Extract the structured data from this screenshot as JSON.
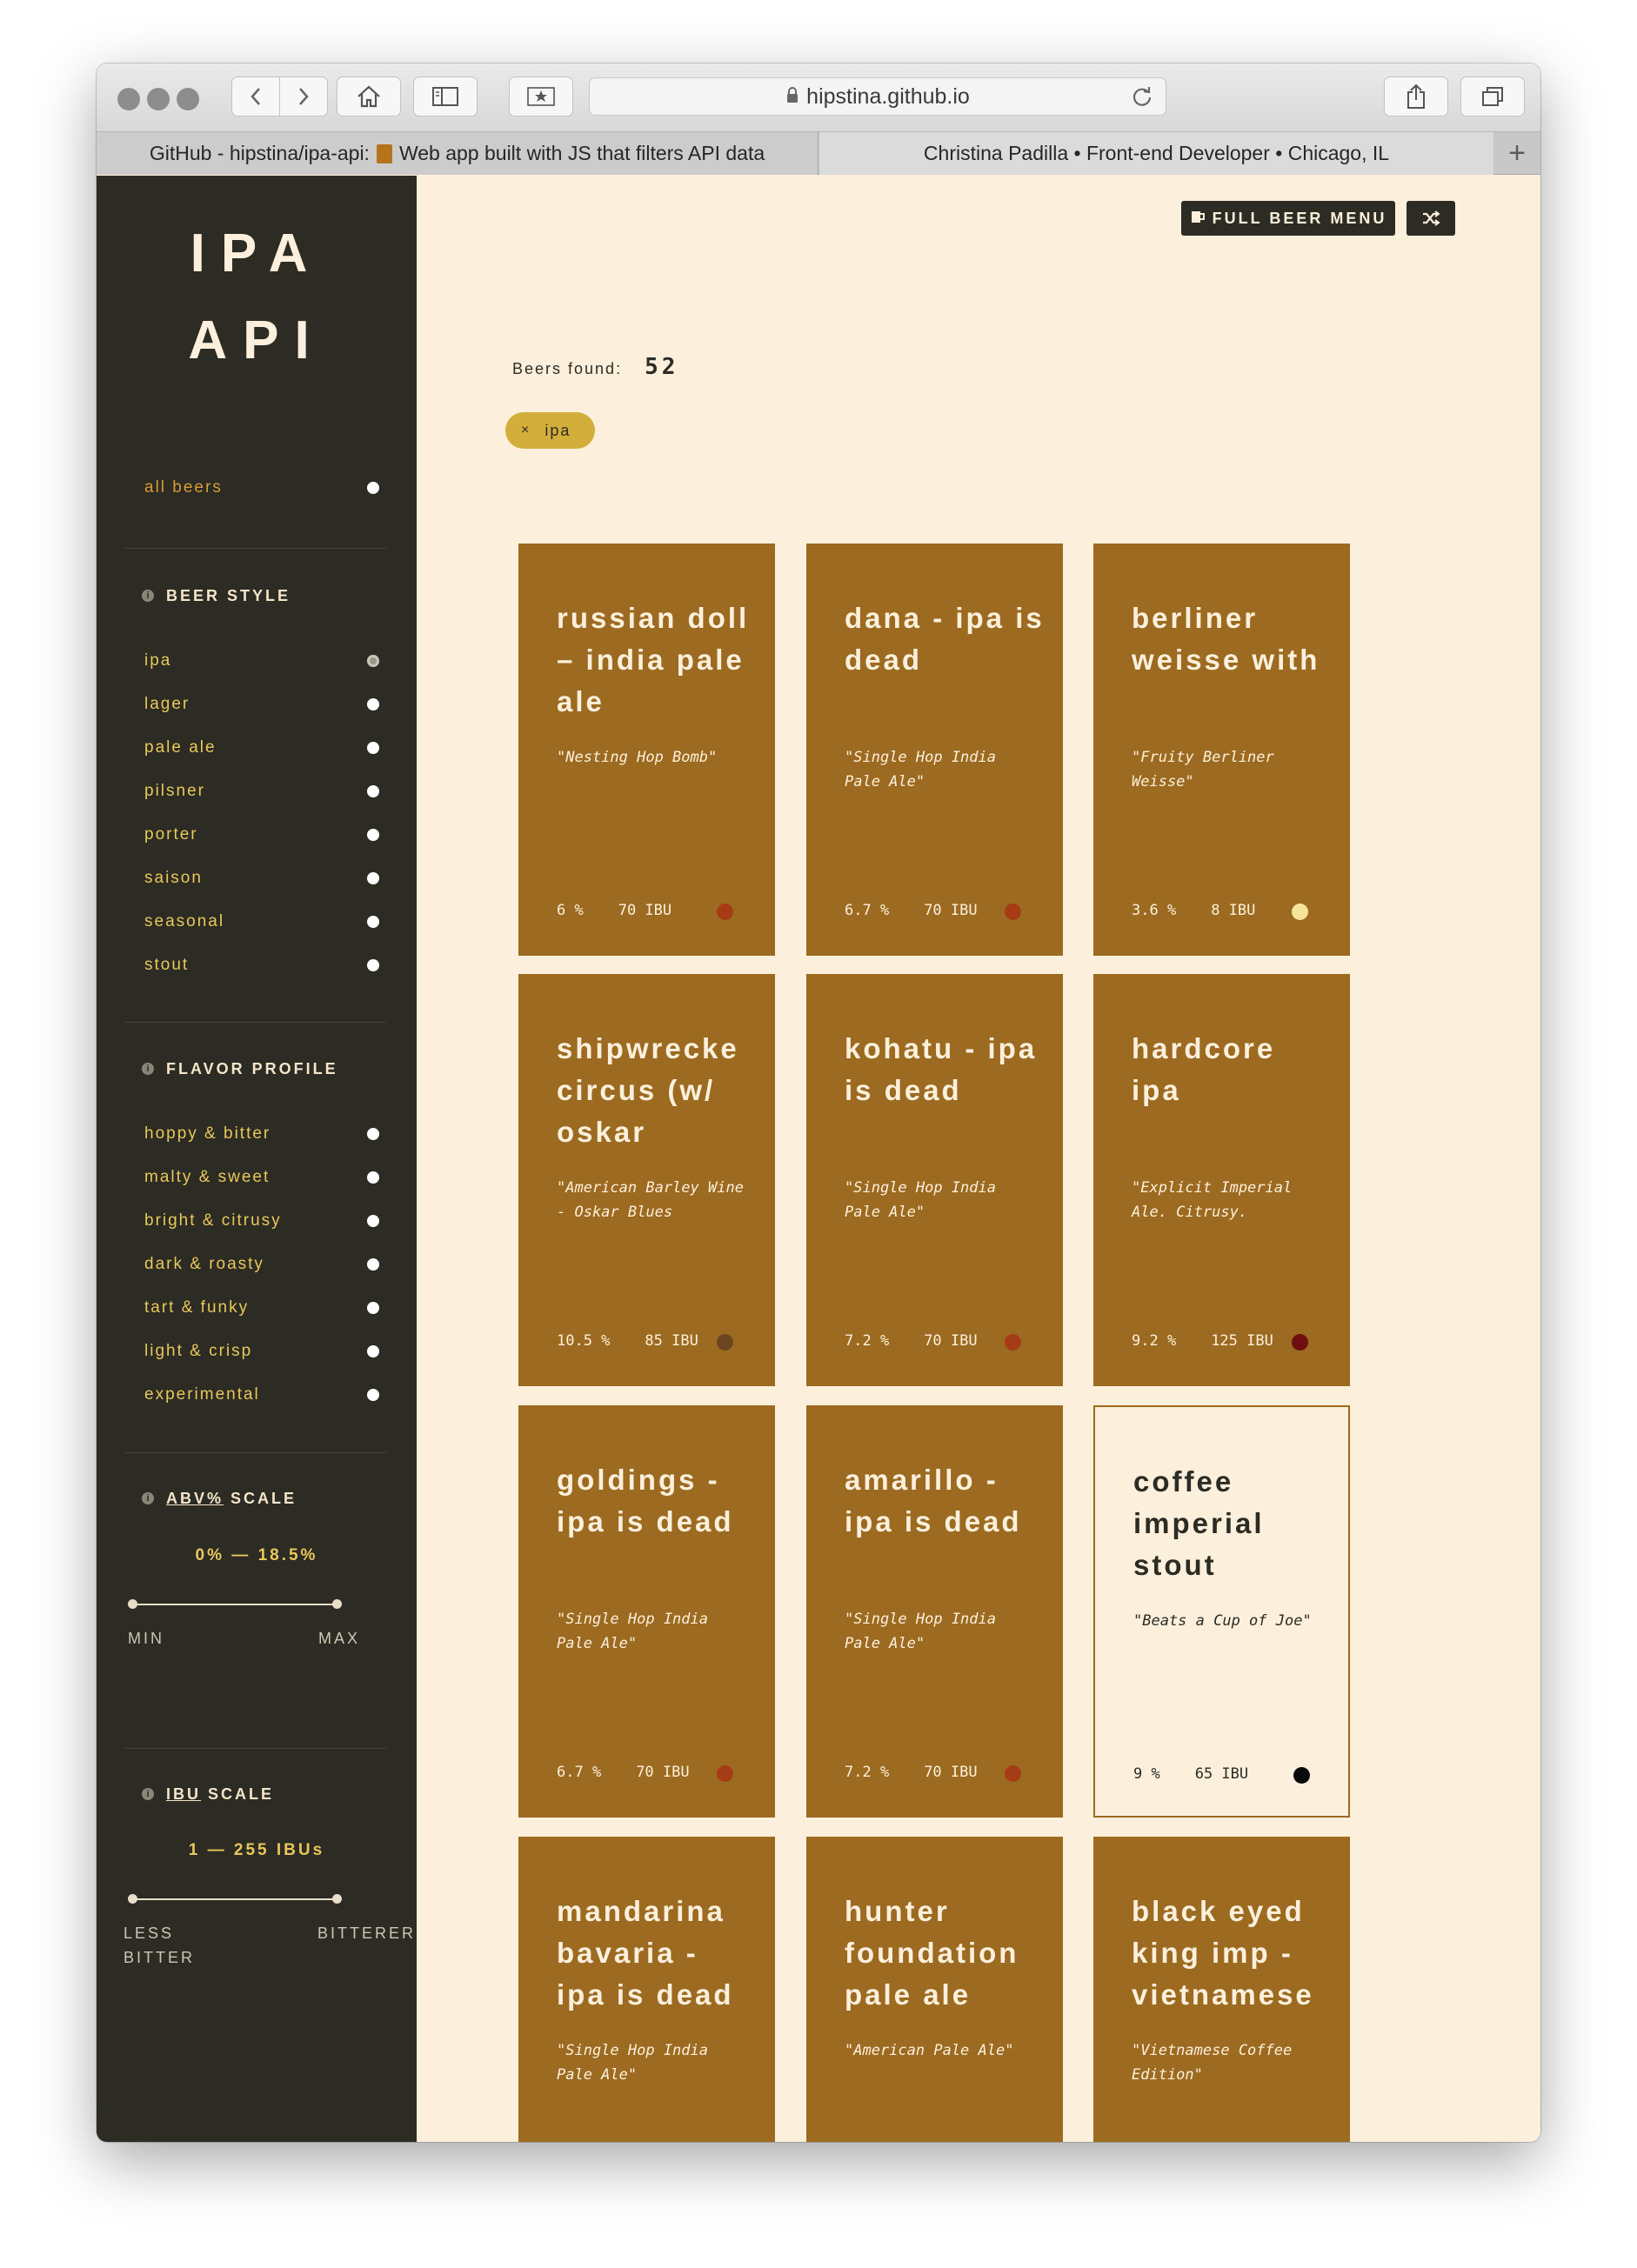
{
  "browser": {
    "url": "hipstina.github.io",
    "tabs": [
      {
        "label_prefix": "GitHub - hipstina/ipa-api:",
        "label_suffix": "Web app built with JS that filters API data"
      },
      {
        "label": "Christina Padilla • Front-end Developer • Chicago, IL"
      }
    ],
    "new_tab_symbol": "+"
  },
  "sidebar": {
    "brand_line1": "IPA",
    "brand_line2": "API",
    "all_beers": "all beers",
    "beer_style": {
      "heading": "BEER STYLE",
      "items": [
        "ipa",
        "lager",
        "pale ale",
        "pilsner",
        "porter",
        "saison",
        "seasonal",
        "stout"
      ],
      "selected": "ipa"
    },
    "flavor_profile": {
      "heading": "FLAVOR PROFILE",
      "items": [
        "hoppy & bitter",
        "malty & sweet",
        "bright & citrusy",
        "dark & roasty",
        "tart & funky",
        "light & crisp",
        "experimental"
      ]
    },
    "abv_scale": {
      "heading_abbr": "ABV%",
      "heading_rest": "SCALE",
      "readout": "0% — 18.5%",
      "min_label": "MIN",
      "max_label": "MAX"
    },
    "ibu_scale": {
      "heading_abbr": "IBU",
      "heading_rest": "SCALE",
      "readout": "1 — 255 IBUs",
      "min_label_1": "LESS",
      "min_label_2": "BITTER",
      "max_label": "BITTERER"
    }
  },
  "header": {
    "full_menu_label": "FULL BEER MENU",
    "shuffle_icon": "shuffle-icon"
  },
  "results": {
    "label": "Beers found:",
    "count": "52",
    "active_filter": "ipa",
    "remove_symbol": "×"
  },
  "beers": [
    {
      "name": "russian doll – india pale ale",
      "tagline": "\"Nesting Hop Bomb\"",
      "abv": "6 %",
      "ibu": "70 IBU",
      "color": "#a63c16",
      "style": "dark"
    },
    {
      "name": "dana - ipa is dead",
      "tagline": "\"Single Hop India Pale Ale\"",
      "abv": "6.7 %",
      "ibu": "70 IBU",
      "color": "#a63c16",
      "style": "dark"
    },
    {
      "name": "berliner weisse with",
      "tagline": "\"Fruity Berliner Weisse\"",
      "abv": "3.6 %",
      "ibu": "8 IBU",
      "color": "#f7e39a",
      "style": "dark"
    },
    {
      "name": "shipwrecke circus (w/ oskar",
      "tagline": "\"American Barley Wine - Oskar Blues",
      "abv": "10.5 %",
      "ibu": "85 IBU",
      "color": "#6b4620",
      "style": "dark"
    },
    {
      "name": "kohatu - ipa is dead",
      "tagline": "\"Single Hop India Pale Ale\"",
      "abv": "7.2 %",
      "ibu": "70 IBU",
      "color": "#a63c16",
      "style": "dark"
    },
    {
      "name": "hardcore ipa",
      "tagline": "\"Explicit Imperial Ale. Citrusy.",
      "abv": "9.2 %",
      "ibu": "125 IBU",
      "color": "#6e0e0e",
      "style": "dark"
    },
    {
      "name": "goldings - ipa is dead",
      "tagline": "\"Single Hop India Pale Ale\"",
      "abv": "6.7 %",
      "ibu": "70 IBU",
      "color": "#a63c16",
      "style": "dark"
    },
    {
      "name": "amarillo - ipa is dead",
      "tagline": "\"Single Hop India Pale Ale\"",
      "abv": "7.2 %",
      "ibu": "70 IBU",
      "color": "#a63c16",
      "style": "dark"
    },
    {
      "name": "coffee imperial stout",
      "tagline": "\"Beats a Cup of Joe\"",
      "abv": "9 %",
      "ibu": "65 IBU",
      "color": "#0a0a0a",
      "style": "light"
    },
    {
      "name": "mandarina bavaria - ipa is dead",
      "tagline": "\"Single Hop India Pale Ale\"",
      "abv": "",
      "ibu": "",
      "color": "",
      "style": "dark"
    },
    {
      "name": "hunter foundation pale ale",
      "tagline": "\"American Pale Ale\"",
      "abv": "",
      "ibu": "",
      "color": "",
      "style": "dark"
    },
    {
      "name": "black eyed king imp - vietnamese",
      "tagline": "\"Vietnamese Coffee Edition\"",
      "abv": "",
      "ibu": "",
      "color": "",
      "style": "dark"
    }
  ]
}
